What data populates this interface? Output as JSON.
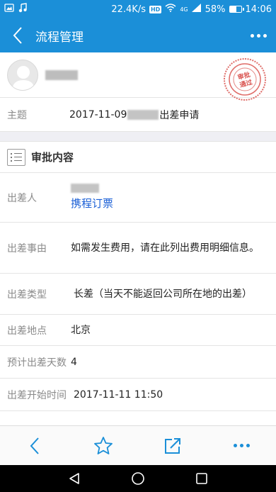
{
  "status_bar": {
    "speed": "22.4K/s",
    "hd": "HD",
    "network": "4G",
    "battery": "58%",
    "battery_level": 0.58,
    "time": "14:06"
  },
  "header": {
    "title": "流程管理"
  },
  "stamp": {
    "text_line1": "审批",
    "text_line2": "通过",
    "color": "#d9534f"
  },
  "subject": {
    "label": "主题",
    "date": "2017-11-09",
    "suffix": "出差申请"
  },
  "section": {
    "title": "审批内容"
  },
  "fields": {
    "traveler_label": "出差人",
    "traveler_link": "携程订票",
    "reason_label": "出差事由",
    "reason_value": "如需发生费用，请在此列出费用明细信息。",
    "type_label": "出差类型",
    "type_value": "长差（当天不能返回公司所在地的出差）",
    "location_label": "出差地点",
    "location_value": "北京",
    "days_label": "预计出差天数",
    "days_value": "4",
    "start_label": "出差开始时间",
    "start_value": "2017-11-11 11:50"
  },
  "colors": {
    "primary": "#1b8fd8",
    "link": "#1a5fd6"
  }
}
